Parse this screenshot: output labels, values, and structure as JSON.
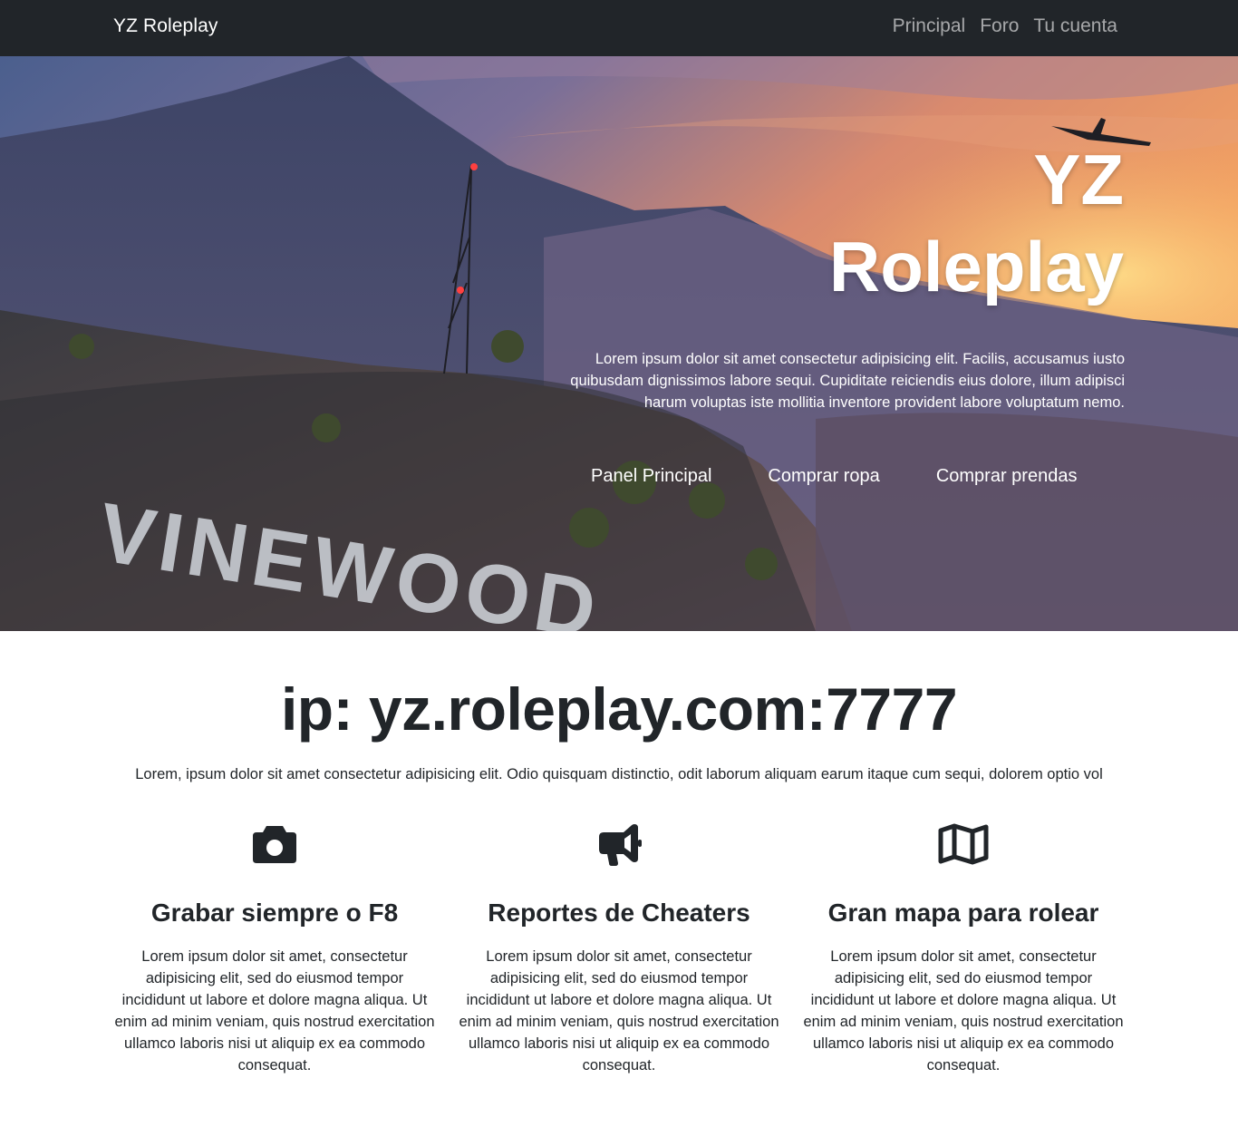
{
  "navbar": {
    "brand": "YZ Roleplay",
    "links": [
      "Principal",
      "Foro",
      "Tu cuenta"
    ]
  },
  "hero": {
    "title_line1": "YZ",
    "title_line2": "Roleplay",
    "description": "Lorem ipsum dolor sit amet consectetur adipisicing elit. Facilis, accusamus iusto quibusdam dignissimos labore sequi. Cupiditate reiciendis eius dolore, illum adipisci harum voluptas iste mollitia inventore provident labore voluptatum nemo.",
    "actions": [
      "Panel Principal",
      "Comprar ropa",
      "Comprar prendas"
    ],
    "background_sign": "VINEWOOD"
  },
  "main": {
    "ip_heading": "ip: yz.roleplay.com:7777",
    "lead": "Lorem, ipsum dolor sit amet consectetur adipisicing elit. Odio quisquam distinctio, odit laborum aliquam earum itaque cum sequi, dolorem optio vol"
  },
  "features": [
    {
      "icon": "camera-icon",
      "title": "Grabar siempre o F8",
      "text": "Lorem ipsum dolor sit amet, consectetur adipisicing elit, sed do eiusmod tempor incididunt ut labore et dolore magna aliqua. Ut enim ad minim veniam, quis nostrud exercitation ullamco laboris nisi ut aliquip ex ea commodo consequat."
    },
    {
      "icon": "megaphone-icon",
      "title": "Reportes de Cheaters",
      "text": "Lorem ipsum dolor sit amet, consectetur adipisicing elit, sed do eiusmod tempor incididunt ut labore et dolore magna aliqua. Ut enim ad minim veniam, quis nostrud exercitation ullamco laboris nisi ut aliquip ex ea commodo consequat."
    },
    {
      "icon": "map-icon",
      "title": "Gran mapa para rolear",
      "text": "Lorem ipsum dolor sit amet, consectetur adipisicing elit, sed do eiusmod tempor incididunt ut labore et dolore magna aliqua. Ut enim ad minim veniam, quis nostrud exercitation ullamco laboris nisi ut aliquip ex ea commodo consequat."
    }
  ],
  "colors": {
    "navbar_bg": "#212529",
    "text_dark": "#212529",
    "nav_link": "rgba(255,255,255,0.6)"
  }
}
